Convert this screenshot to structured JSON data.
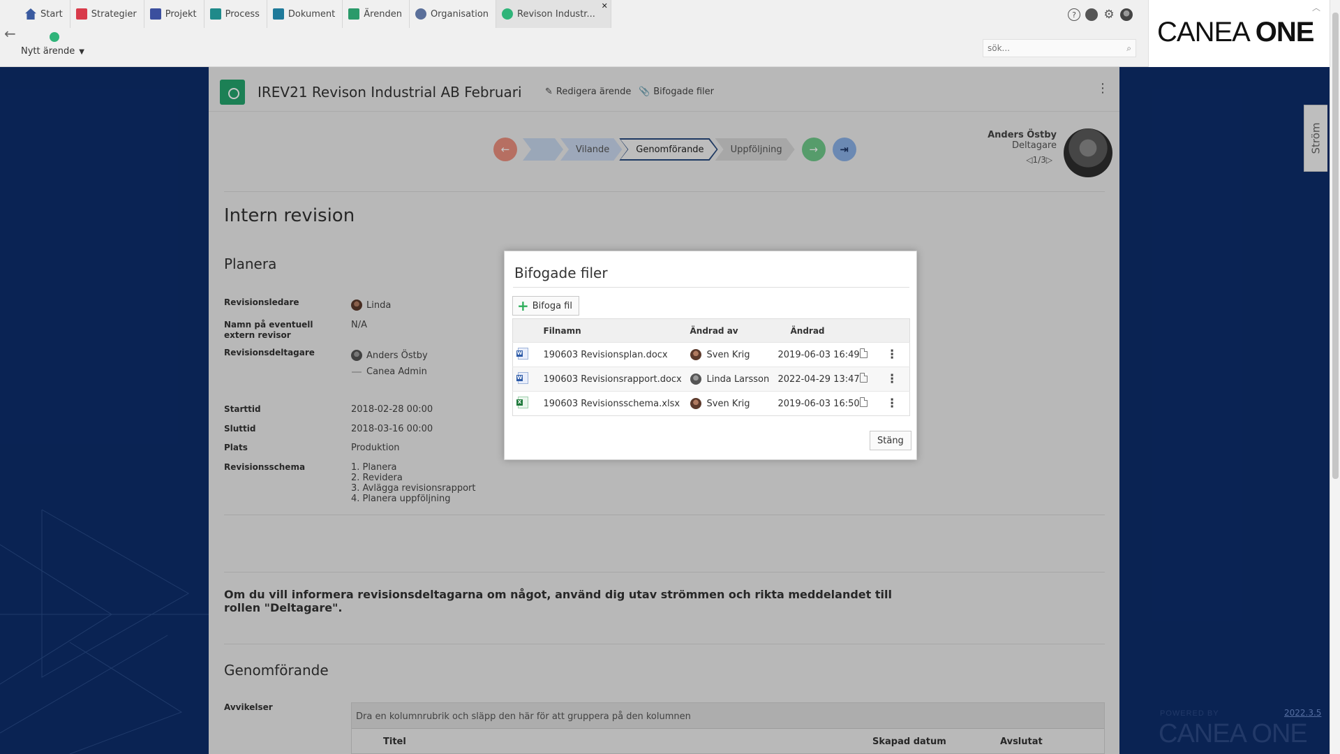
{
  "tabs": [
    {
      "label": "Start",
      "icon": "home-icon",
      "color": "#3a5aa0"
    },
    {
      "label": "Strategier",
      "icon": "strategy-icon",
      "color": "#d83a4a"
    },
    {
      "label": "Projekt",
      "icon": "project-icon",
      "color": "#3b4f9e"
    },
    {
      "label": "Process",
      "icon": "process-icon",
      "color": "#1f8a8a"
    },
    {
      "label": "Dokument",
      "icon": "document-icon",
      "color": "#1f7a9a"
    },
    {
      "label": "Ärenden",
      "icon": "case-icon",
      "color": "#2a9a6a"
    },
    {
      "label": "Organisation",
      "icon": "organisation-icon",
      "color": "#5a6f9a"
    },
    {
      "label": "Revison Industr...",
      "icon": "case-icon",
      "color": "#2fb479",
      "active": true
    }
  ],
  "toolbar": {
    "new_case_label": "Nytt ärende"
  },
  "search": {
    "placeholder": "sök..."
  },
  "logo": {
    "text_light": "CANEA ",
    "text_bold": "ONE"
  },
  "case": {
    "title": "IREV21 Revison Industrial AB Februari",
    "edit_label": "Redigera ärende",
    "attachments_label": "Bifogade filer"
  },
  "workflow": {
    "steps": [
      "Vilande",
      "Genomförande",
      "Uppföljning"
    ],
    "current": "Genomförande"
  },
  "participant": {
    "name": "Anders Östby",
    "role": "Deltagare",
    "pager": "1/3"
  },
  "section": {
    "title": "Intern revision",
    "planera": "Planera",
    "genomforande": "Genomförande"
  },
  "fields": {
    "revisionsledare_label": "Revisionsledare",
    "revisionsledare_value": "Linda",
    "extern_label": "Namn på eventuell extern revisor",
    "extern_value": "N/A",
    "deltagare_label": "Revisionsdeltagare",
    "deltagare_1": "Anders Östby",
    "deltagare_2": "Canea Admin",
    "starttid_label": "Starttid",
    "starttid_value": "2018-02-28 00:00",
    "sluttid_label": "Sluttid",
    "sluttid_value": "2018-03-16 00:00",
    "plats_label": "Plats",
    "plats_value": "Produktion",
    "schema_label": "Revisionsschema",
    "schema_items": [
      "1. Planera",
      "2. Revidera",
      "3. Avlägga revisionsrapport",
      "4. Planera uppföljning"
    ]
  },
  "info_text": "Om du vill informera revisionsdeltagarna om något, använd dig utav strömmen och rikta meddelandet till rollen \"Deltagare\".",
  "deviations": {
    "label": "Avvikelser",
    "drop_hint": "Dra en kolumnrubrik och släpp den här för att gruppera på den kolumnen",
    "col_title": "Titel",
    "col_created": "Skapad datum",
    "col_closed": "Avslutat"
  },
  "stream_tab": "Ström",
  "powered": {
    "caption": "POWERED BY",
    "logo": "CANEA ONE",
    "version": "2022.3.5"
  },
  "dialog": {
    "title": "Bifogade filer",
    "attach_label": "Bifoga fil",
    "close_label": "Stäng",
    "columns": {
      "filename": "Filnamn",
      "changed_by": "Ändrad av",
      "changed": "Ändrad"
    },
    "files": [
      {
        "type": "word",
        "name": "190603 Revisionsplan.docx",
        "user": "Sven Krig",
        "date": "2019-06-03 16:49"
      },
      {
        "type": "word",
        "name": "190603 Revisionsrapport.docx",
        "user": "Linda Larsson",
        "date": "2022-04-29 13:47"
      },
      {
        "type": "excel",
        "name": "190603 Revisionsschema.xlsx",
        "user": "Sven Krig",
        "date": "2019-06-03 16:50"
      }
    ]
  }
}
